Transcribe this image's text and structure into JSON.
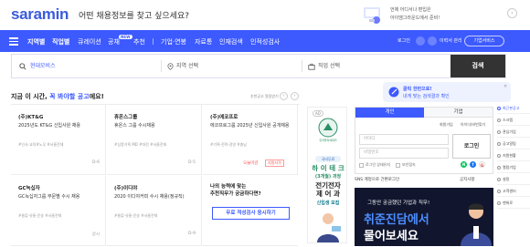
{
  "header": {
    "logo": "saramin",
    "tagline": "어떤 채용정보를 찾고 싶으세요?",
    "promo_line1": "언제 어디서나 편입은",
    "promo_line2": "아이엠그라운드에서 준비!"
  },
  "nav": {
    "items": [
      "지역별",
      "직업별",
      "큐레이션",
      "공채",
      "추천"
    ],
    "new_badge": "NEW",
    "items2": [
      "기업·연봉",
      "자료통",
      "인재검색",
      "인적성검사"
    ],
    "login": "로그인",
    "member": "회원가입",
    "my_label": "이력서 관리",
    "service_btn": "기업서비스"
  },
  "search": {
    "keyword": "현대모비스",
    "region_placeholder": "지역 선택",
    "job_placeholder": "직업 선택",
    "button": "검색"
  },
  "bubble": {
    "line1": "클릭 한번으로!",
    "line2": "내게 맞는 검색결과 확인"
  },
  "section": {
    "title_prefix": "지금 이 시간, ",
    "title_highlight": "꼭 봐야할 공고",
    "title_suffix": "에요!",
    "link": "추천공고 알림받기",
    "prev": "‹",
    "next": "›"
  },
  "cards": [
    {
      "company": "(주)KT&G",
      "title": "2025년도 KT&G 신입사원 채용",
      "tags": "#인사·교육#노무 #서울전체",
      "dday": "D-6"
    },
    {
      "company": "휴온스그룹",
      "title": "휴온스 그룹 수시채용",
      "tags": "#상품기획 MD #대전 #서울전체",
      "dday": "D-5"
    },
    {
      "company": "(주)에코프로",
      "title": "에코프로그룹 2025년 신입사원 공개채용",
      "tags": "#기획·전략·경영 #충남",
      "urgent": "오늘마감",
      "urgent2": "지원자격",
      "dday": ""
    },
    {
      "company": "GC녹십자",
      "title": "GC녹십자그룹 부문별 수시 채용",
      "tags": "#물류·유통·운송 #서울전체",
      "dday": "상시"
    },
    {
      "company": "(주)이디야",
      "title": "2020 이디야커피 수시 채용(정규직)",
      "tags": "#물류·유통·운송 #서울전체",
      "dday": "D-9"
    }
  ],
  "cta": {
    "question_line1": "나의 능력에 맞는",
    "question_line2": "추천직무가 궁금하다면?",
    "button": "무료 적성검사 응시하기"
  },
  "ad": {
    "badge": "AD",
    "org": "한국폴리텍대학",
    "pill": "국비무료",
    "big1": "하 이 테 크",
    "big2": "(3개월) 과정",
    "big3": "전기전자",
    "big4": "제 어 과",
    "small": "신입생 모집"
  },
  "login": {
    "tab_personal": "개인",
    "tab_company": "기업",
    "find_id": "회원가입",
    "find_pw": "아이디/비번찾기",
    "id_placeholder": "아이디",
    "pw_placeholder": "비밀번호",
    "button": "로그인",
    "keep": "로그인 상태유지",
    "secure": "보안접속",
    "social": [
      "N",
      "f",
      "G"
    ]
  },
  "notes": {
    "sns": "SNS 계정으로 간편로그인",
    "notice": "공지사항"
  },
  "banner": {
    "line1": "그동안 궁금했던 기업과 직무!",
    "line2": "취준진담에서",
    "line3": "물어보세요"
  },
  "side": {
    "items": [
      "최근본공고",
      "스크랩",
      "관심기업",
      "공고알림",
      "지원현황",
      "열람기업",
      "설정",
      "고객센터",
      "맨위로"
    ]
  },
  "colors": {
    "brand": "#3d5afe",
    "logo": "#3b5bdb",
    "urgent": "#ff4d4d",
    "banner_bg": "#11162e"
  }
}
